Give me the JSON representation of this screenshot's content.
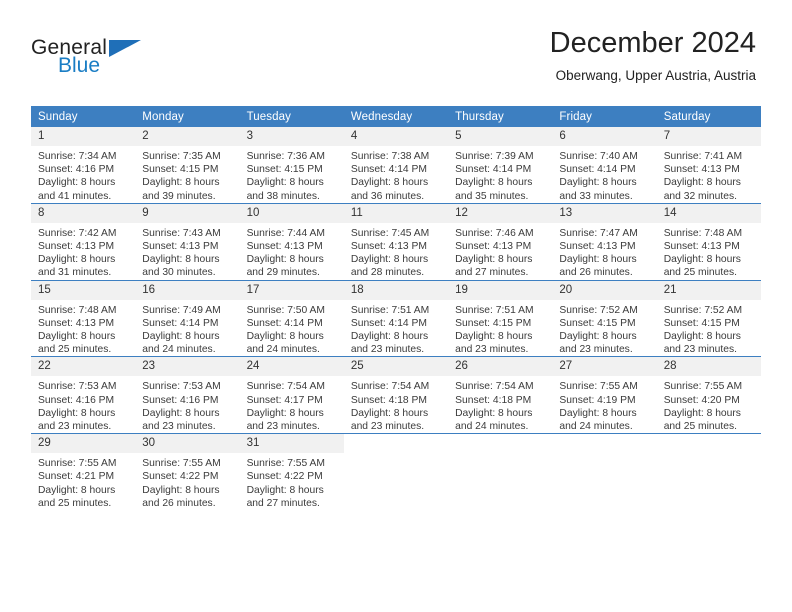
{
  "logo": {
    "primary_text": "General",
    "secondary_text": "Blue",
    "primary_color": "#222222",
    "secondary_color": "#1a7dc4",
    "triangle_color": "#1f6fb8"
  },
  "header": {
    "title": "December 2024",
    "location": "Oberwang, Upper Austria, Austria"
  },
  "calendar": {
    "header_color": "#3d7fc1",
    "daynum_background": "#f1f1f1",
    "weekday_headers": [
      "Sunday",
      "Monday",
      "Tuesday",
      "Wednesday",
      "Thursday",
      "Friday",
      "Saturday"
    ],
    "weeks": [
      [
        {
          "day": "1",
          "sunrise": "Sunrise: 7:34 AM",
          "sunset": "Sunset: 4:16 PM",
          "daylight_1": "Daylight: 8 hours",
          "daylight_2": "and 41 minutes."
        },
        {
          "day": "2",
          "sunrise": "Sunrise: 7:35 AM",
          "sunset": "Sunset: 4:15 PM",
          "daylight_1": "Daylight: 8 hours",
          "daylight_2": "and 39 minutes."
        },
        {
          "day": "3",
          "sunrise": "Sunrise: 7:36 AM",
          "sunset": "Sunset: 4:15 PM",
          "daylight_1": "Daylight: 8 hours",
          "daylight_2": "and 38 minutes."
        },
        {
          "day": "4",
          "sunrise": "Sunrise: 7:38 AM",
          "sunset": "Sunset: 4:14 PM",
          "daylight_1": "Daylight: 8 hours",
          "daylight_2": "and 36 minutes."
        },
        {
          "day": "5",
          "sunrise": "Sunrise: 7:39 AM",
          "sunset": "Sunset: 4:14 PM",
          "daylight_1": "Daylight: 8 hours",
          "daylight_2": "and 35 minutes."
        },
        {
          "day": "6",
          "sunrise": "Sunrise: 7:40 AM",
          "sunset": "Sunset: 4:14 PM",
          "daylight_1": "Daylight: 8 hours",
          "daylight_2": "and 33 minutes."
        },
        {
          "day": "7",
          "sunrise": "Sunrise: 7:41 AM",
          "sunset": "Sunset: 4:13 PM",
          "daylight_1": "Daylight: 8 hours",
          "daylight_2": "and 32 minutes."
        }
      ],
      [
        {
          "day": "8",
          "sunrise": "Sunrise: 7:42 AM",
          "sunset": "Sunset: 4:13 PM",
          "daylight_1": "Daylight: 8 hours",
          "daylight_2": "and 31 minutes."
        },
        {
          "day": "9",
          "sunrise": "Sunrise: 7:43 AM",
          "sunset": "Sunset: 4:13 PM",
          "daylight_1": "Daylight: 8 hours",
          "daylight_2": "and 30 minutes."
        },
        {
          "day": "10",
          "sunrise": "Sunrise: 7:44 AM",
          "sunset": "Sunset: 4:13 PM",
          "daylight_1": "Daylight: 8 hours",
          "daylight_2": "and 29 minutes."
        },
        {
          "day": "11",
          "sunrise": "Sunrise: 7:45 AM",
          "sunset": "Sunset: 4:13 PM",
          "daylight_1": "Daylight: 8 hours",
          "daylight_2": "and 28 minutes."
        },
        {
          "day": "12",
          "sunrise": "Sunrise: 7:46 AM",
          "sunset": "Sunset: 4:13 PM",
          "daylight_1": "Daylight: 8 hours",
          "daylight_2": "and 27 minutes."
        },
        {
          "day": "13",
          "sunrise": "Sunrise: 7:47 AM",
          "sunset": "Sunset: 4:13 PM",
          "daylight_1": "Daylight: 8 hours",
          "daylight_2": "and 26 minutes."
        },
        {
          "day": "14",
          "sunrise": "Sunrise: 7:48 AM",
          "sunset": "Sunset: 4:13 PM",
          "daylight_1": "Daylight: 8 hours",
          "daylight_2": "and 25 minutes."
        }
      ],
      [
        {
          "day": "15",
          "sunrise": "Sunrise: 7:48 AM",
          "sunset": "Sunset: 4:13 PM",
          "daylight_1": "Daylight: 8 hours",
          "daylight_2": "and 25 minutes."
        },
        {
          "day": "16",
          "sunrise": "Sunrise: 7:49 AM",
          "sunset": "Sunset: 4:14 PM",
          "daylight_1": "Daylight: 8 hours",
          "daylight_2": "and 24 minutes."
        },
        {
          "day": "17",
          "sunrise": "Sunrise: 7:50 AM",
          "sunset": "Sunset: 4:14 PM",
          "daylight_1": "Daylight: 8 hours",
          "daylight_2": "and 24 minutes."
        },
        {
          "day": "18",
          "sunrise": "Sunrise: 7:51 AM",
          "sunset": "Sunset: 4:14 PM",
          "daylight_1": "Daylight: 8 hours",
          "daylight_2": "and 23 minutes."
        },
        {
          "day": "19",
          "sunrise": "Sunrise: 7:51 AM",
          "sunset": "Sunset: 4:15 PM",
          "daylight_1": "Daylight: 8 hours",
          "daylight_2": "and 23 minutes."
        },
        {
          "day": "20",
          "sunrise": "Sunrise: 7:52 AM",
          "sunset": "Sunset: 4:15 PM",
          "daylight_1": "Daylight: 8 hours",
          "daylight_2": "and 23 minutes."
        },
        {
          "day": "21",
          "sunrise": "Sunrise: 7:52 AM",
          "sunset": "Sunset: 4:15 PM",
          "daylight_1": "Daylight: 8 hours",
          "daylight_2": "and 23 minutes."
        }
      ],
      [
        {
          "day": "22",
          "sunrise": "Sunrise: 7:53 AM",
          "sunset": "Sunset: 4:16 PM",
          "daylight_1": "Daylight: 8 hours",
          "daylight_2": "and 23 minutes."
        },
        {
          "day": "23",
          "sunrise": "Sunrise: 7:53 AM",
          "sunset": "Sunset: 4:16 PM",
          "daylight_1": "Daylight: 8 hours",
          "daylight_2": "and 23 minutes."
        },
        {
          "day": "24",
          "sunrise": "Sunrise: 7:54 AM",
          "sunset": "Sunset: 4:17 PM",
          "daylight_1": "Daylight: 8 hours",
          "daylight_2": "and 23 minutes."
        },
        {
          "day": "25",
          "sunrise": "Sunrise: 7:54 AM",
          "sunset": "Sunset: 4:18 PM",
          "daylight_1": "Daylight: 8 hours",
          "daylight_2": "and 23 minutes."
        },
        {
          "day": "26",
          "sunrise": "Sunrise: 7:54 AM",
          "sunset": "Sunset: 4:18 PM",
          "daylight_1": "Daylight: 8 hours",
          "daylight_2": "and 24 minutes."
        },
        {
          "day": "27",
          "sunrise": "Sunrise: 7:55 AM",
          "sunset": "Sunset: 4:19 PM",
          "daylight_1": "Daylight: 8 hours",
          "daylight_2": "and 24 minutes."
        },
        {
          "day": "28",
          "sunrise": "Sunrise: 7:55 AM",
          "sunset": "Sunset: 4:20 PM",
          "daylight_1": "Daylight: 8 hours",
          "daylight_2": "and 25 minutes."
        }
      ],
      [
        {
          "day": "29",
          "sunrise": "Sunrise: 7:55 AM",
          "sunset": "Sunset: 4:21 PM",
          "daylight_1": "Daylight: 8 hours",
          "daylight_2": "and 25 minutes."
        },
        {
          "day": "30",
          "sunrise": "Sunrise: 7:55 AM",
          "sunset": "Sunset: 4:22 PM",
          "daylight_1": "Daylight: 8 hours",
          "daylight_2": "and 26 minutes."
        },
        {
          "day": "31",
          "sunrise": "Sunrise: 7:55 AM",
          "sunset": "Sunset: 4:22 PM",
          "daylight_1": "Daylight: 8 hours",
          "daylight_2": "and 27 minutes."
        },
        {
          "day": "",
          "sunrise": "",
          "sunset": "",
          "daylight_1": "",
          "daylight_2": ""
        },
        {
          "day": "",
          "sunrise": "",
          "sunset": "",
          "daylight_1": "",
          "daylight_2": ""
        },
        {
          "day": "",
          "sunrise": "",
          "sunset": "",
          "daylight_1": "",
          "daylight_2": ""
        },
        {
          "day": "",
          "sunrise": "",
          "sunset": "",
          "daylight_1": "",
          "daylight_2": ""
        }
      ]
    ]
  }
}
